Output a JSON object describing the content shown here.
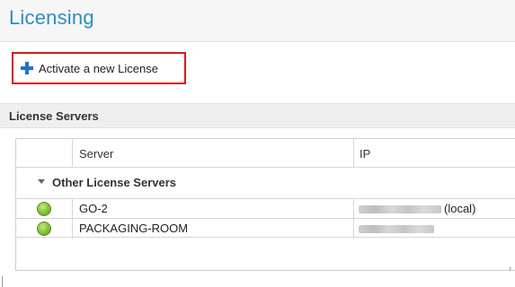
{
  "header": {
    "title": "Licensing"
  },
  "actions": {
    "activate_label": "Activate a new License",
    "activate_icon": "plus-icon"
  },
  "section": {
    "title": "License Servers"
  },
  "grid": {
    "columns": [
      "Server",
      "IP"
    ],
    "group": {
      "label": "Other License Servers",
      "expanded": true
    },
    "rows": [
      {
        "status": "online",
        "server": "GO-2",
        "ip_redacted": true,
        "ip_suffix": "(local)"
      },
      {
        "status": "online",
        "server": "PACKAGING-ROOM",
        "ip_redacted": true,
        "ip_suffix": ""
      }
    ]
  },
  "colors": {
    "accent": "#2b8ec4",
    "highlight_border": "#d61a1a",
    "status_online": "#8cc63a",
    "plus_icon": "#1e73c9"
  }
}
